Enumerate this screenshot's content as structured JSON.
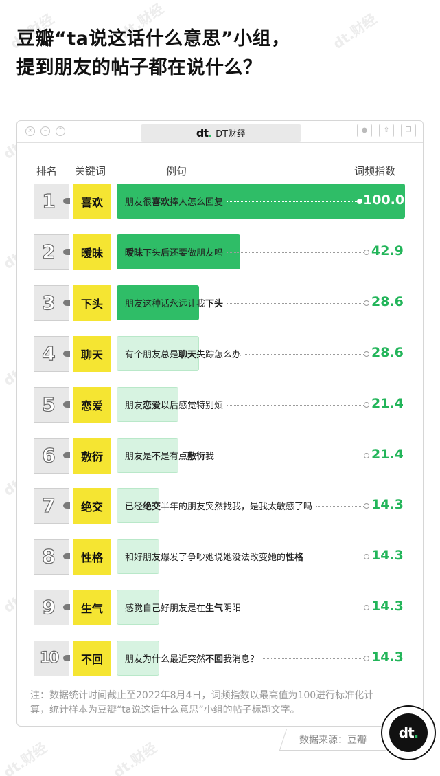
{
  "title_lines": [
    "豆瓣“ta说这话什么意思”小组，",
    "提到朋友的帖子都在说什么？"
  ],
  "window": {
    "brand_logo": "dt",
    "brand_name": "DT财经"
  },
  "columns": {
    "rank": "排名",
    "keyword": "关键词",
    "example": "例句",
    "index": "词频指数"
  },
  "colors": {
    "accent_green": "#2bbf66",
    "value_green": "#23b55a",
    "keyword_yellow": "#f5e532",
    "bar_high": "#2fbd67",
    "bar_mid": "#62d089",
    "bar_low": "#d7f3e1"
  },
  "chart_data": {
    "type": "bar",
    "orientation": "horizontal",
    "categories": [
      "喜欢",
      "暧昧",
      "下头",
      "聊天",
      "恋爱",
      "敷衍",
      "绝交",
      "性格",
      "生气",
      "不回"
    ],
    "values": [
      100.0,
      42.9,
      28.6,
      28.6,
      21.4,
      21.4,
      14.3,
      14.3,
      14.3,
      14.3
    ],
    "value_labels": [
      "100.0",
      "42.9",
      "28.6",
      "28.6",
      "21.4",
      "21.4",
      "14.3",
      "14.3",
      "14.3",
      "14.3"
    ],
    "ranks": [
      "1",
      "2",
      "3",
      "4",
      "5",
      "6",
      "7",
      "8",
      "9",
      "10"
    ],
    "examples": [
      {
        "pre": "朋友很",
        "kw": "喜欢",
        "post": "捧人怎么回复"
      },
      {
        "pre": "",
        "kw": "暧昧",
        "post": "下头后还要做朋友吗"
      },
      {
        "pre": "朋友这种话永远让我",
        "kw": "下头",
        "post": ""
      },
      {
        "pre": "有个朋友总是",
        "kw": "聊天",
        "post": "失踪怎么办"
      },
      {
        "pre": "朋友",
        "kw": "恋爱",
        "post": "以后感觉特别烦"
      },
      {
        "pre": "朋友是不是有点",
        "kw": "敷衍",
        "post": "我"
      },
      {
        "pre": "已经",
        "kw": "绝交",
        "post": "半年的朋友突然找我，是我太敏感了吗"
      },
      {
        "pre": "和好朋友爆发了争吵她说她没法改变她的",
        "kw": "性格",
        "post": ""
      },
      {
        "pre": "感觉自己好朋友是在",
        "kw": "生气",
        "post": "阴阳"
      },
      {
        "pre": "朋友为什么最近突然",
        "kw": "不回",
        "post": "我消息？"
      }
    ],
    "xlim": [
      0,
      100
    ],
    "ylabel": "关键词",
    "xlabel": "词频指数"
  },
  "note": "注：数据统计时间截止至2022年8月4日，词频指数以最高值为100进行标准化计算，统计样本为豆瓣“ta说这话什么意思”小组的帖子标题文字。",
  "source": "数据来源：豆瓣",
  "watermark": "dt.财经"
}
